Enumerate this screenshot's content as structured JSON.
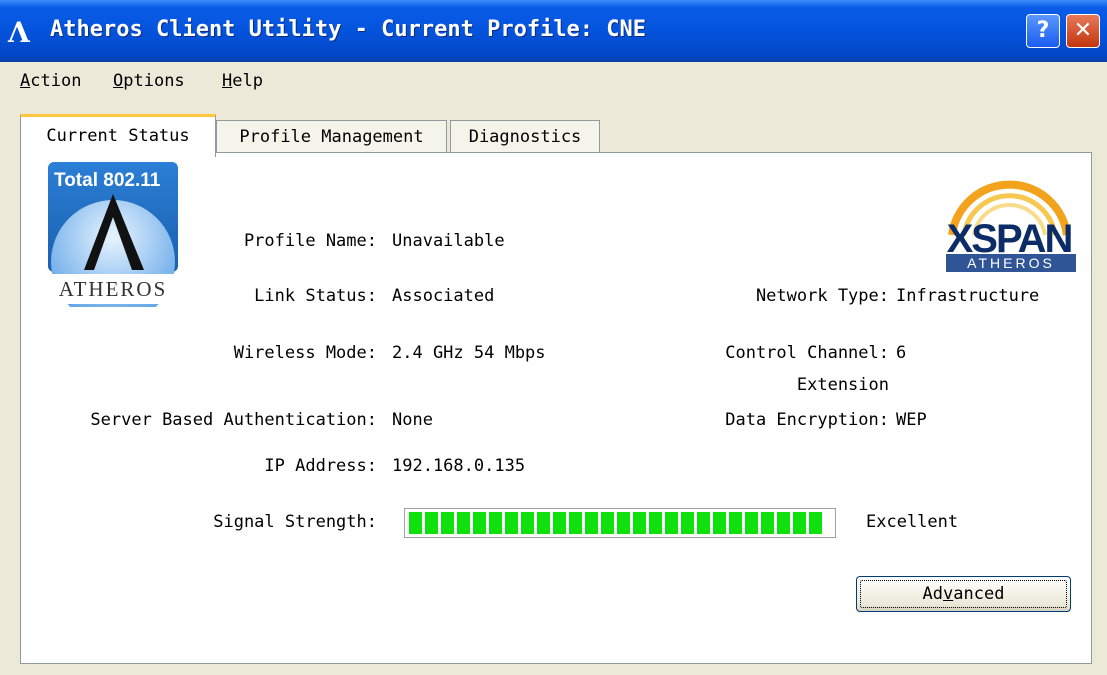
{
  "window": {
    "title": "Atheros Client Utility - Current Profile: CNE",
    "icon": "atheros-a-icon",
    "help_glyph": "?",
    "close_glyph": "✕"
  },
  "menu": [
    {
      "label": "Action",
      "mnemonic": "A"
    },
    {
      "label": "Options",
      "mnemonic": "O"
    },
    {
      "label": "Help",
      "mnemonic": "H"
    }
  ],
  "tabs": [
    {
      "label": "Current Status",
      "selected": true
    },
    {
      "label": "Profile Management",
      "selected": false
    },
    {
      "label": "Diagnostics",
      "selected": false
    }
  ],
  "logos": {
    "atheros": {
      "top_text": "Total 802.11",
      "bottom_text": "ATHEROS"
    },
    "xspan": {
      "main_text": "XSPAN",
      "sub_text": "ATHEROS"
    }
  },
  "status": {
    "profile_name_label": "Profile Name:",
    "profile_name_value": "Unavailable",
    "link_status_label": "Link Status:",
    "link_status_value": "Associated",
    "wireless_mode_label": "Wireless Mode:",
    "wireless_mode_value": "2.4 GHz 54 Mbps",
    "auth_label": "Server Based Authentication:",
    "auth_value": "None",
    "ip_label": "IP Address:",
    "ip_value": "192.168.0.135",
    "network_type_label": "Network Type:",
    "network_type_value": "Infrastructure",
    "control_channel_label": "Control Channel:",
    "control_channel_value": "6",
    "extension_label": "Extension",
    "data_encryption_label": "Data Encryption:",
    "data_encryption_value": "WEP",
    "signal_label": "Signal Strength:",
    "signal_value": "Excellent",
    "signal_level": 1.0,
    "signal_color": "#0ee10e"
  },
  "buttons": {
    "advanced": "Advanced",
    "advanced_mnemonic": "v"
  },
  "colors": {
    "titlebar": "#0453dc",
    "tab_highlight": "#ffc73c",
    "window_bg": "#ece9d8"
  }
}
